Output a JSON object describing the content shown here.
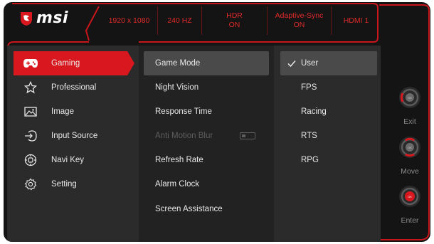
{
  "brand": {
    "name": "msi"
  },
  "status_bar": [
    {
      "text": "1920 x 1080"
    },
    {
      "text": "240 HZ"
    },
    {
      "text": "HDR\nON"
    },
    {
      "text": "Adaptive-Sync\nON"
    },
    {
      "text": "HDMI 1"
    }
  ],
  "main_menu": [
    {
      "label": "Gaming",
      "icon": "gamepad-icon",
      "active": true
    },
    {
      "label": "Professional",
      "icon": "star-icon"
    },
    {
      "label": "Image",
      "icon": "image-icon"
    },
    {
      "label": "Input Source",
      "icon": "input-source-icon"
    },
    {
      "label": "Navi Key",
      "icon": "navi-key-icon"
    },
    {
      "label": "Setting",
      "icon": "settings-gear-icon"
    }
  ],
  "submenu": [
    {
      "label": "Game Mode",
      "selected": true
    },
    {
      "label": "Night Vision"
    },
    {
      "label": "Response Time"
    },
    {
      "label": "Anti Motion Blur",
      "disabled": true,
      "toggle": "off"
    },
    {
      "label": "Refresh Rate"
    },
    {
      "label": "Alarm Clock"
    },
    {
      "label": "Screen Assistance"
    }
  ],
  "options": [
    {
      "label": "User",
      "selected": true
    },
    {
      "label": "FPS"
    },
    {
      "label": "Racing"
    },
    {
      "label": "RTS"
    },
    {
      "label": "RPG"
    }
  ],
  "controls": [
    {
      "label": "Exit",
      "direction": "left"
    },
    {
      "label": "Move",
      "direction": "up-down"
    },
    {
      "label": "Enter",
      "direction": "center"
    }
  ],
  "colors": {
    "accent": "#d8181e",
    "status_text": "#e02a2a",
    "background": "#141414"
  }
}
